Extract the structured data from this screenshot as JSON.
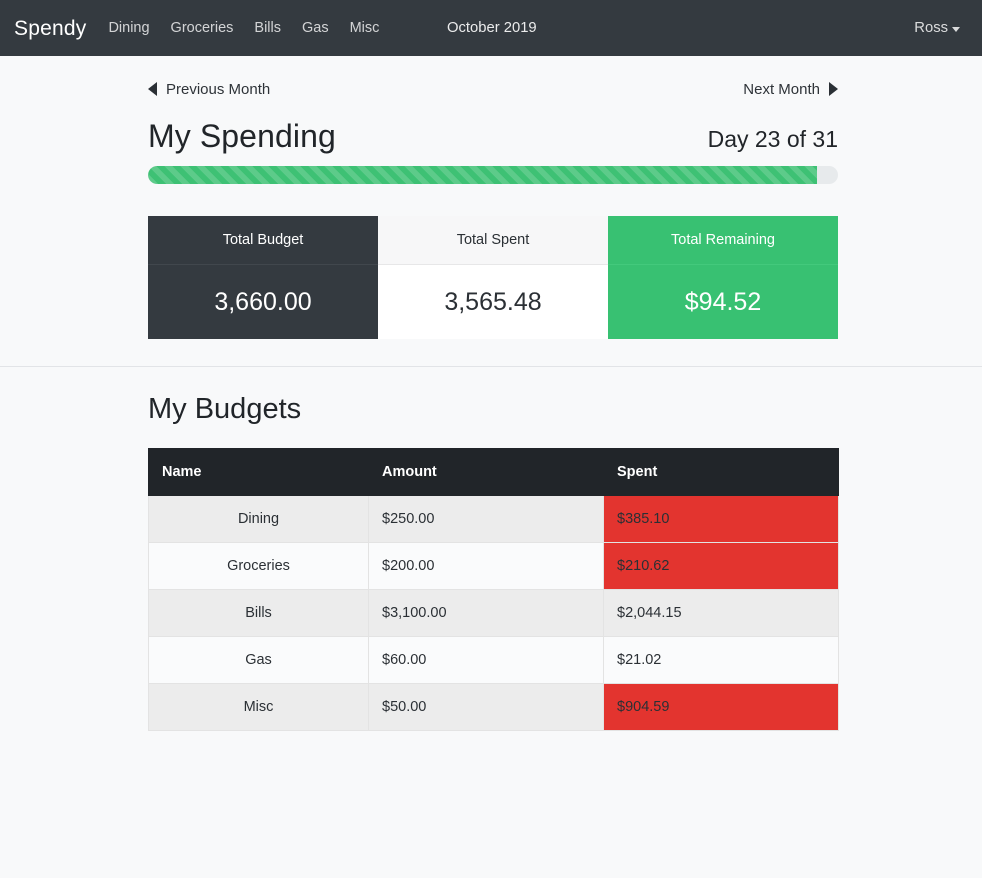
{
  "navbar": {
    "brand": "Spendy",
    "links": [
      {
        "label": "Dining"
      },
      {
        "label": "Groceries"
      },
      {
        "label": "Bills"
      },
      {
        "label": "Gas"
      },
      {
        "label": "Misc"
      }
    ],
    "month": "October 2019",
    "user": "Ross",
    "caret_icon": "chevron-down-icon"
  },
  "month_nav": {
    "previous_label": "Previous Month",
    "next_label": "Next Month",
    "prev_icon": "triangle-left-icon",
    "next_icon": "triangle-right-icon"
  },
  "spending": {
    "title": "My Spending",
    "day_counter": "Day 23 of 31",
    "progress_percent": 97,
    "progress_color": "#3ec174",
    "progress_track_color": "#e7eaec",
    "cards": [
      {
        "label": "Total Budget",
        "value": "3,660.00",
        "style": "dark",
        "color": "#343a40"
      },
      {
        "label": "Total Spent",
        "value": "3,565.48",
        "style": "light",
        "color": "#ffffff"
      },
      {
        "label": "Total Remaining",
        "value": "$94.52",
        "style": "green",
        "color": "#38c172"
      }
    ]
  },
  "budgets": {
    "title": "My Budgets",
    "columns": [
      "Name",
      "Amount",
      "Spent"
    ],
    "over_color": "#e3342f",
    "rows": [
      {
        "name": "Dining",
        "amount": "$250.00",
        "spent": "$385.10",
        "over": true
      },
      {
        "name": "Groceries",
        "amount": "$200.00",
        "spent": "$210.62",
        "over": true
      },
      {
        "name": "Bills",
        "amount": "$3,100.00",
        "spent": "$2,044.15",
        "over": false
      },
      {
        "name": "Gas",
        "amount": "$60.00",
        "spent": "$21.02",
        "over": false
      },
      {
        "name": "Misc",
        "amount": "$50.00",
        "spent": "$904.59",
        "over": true
      }
    ]
  }
}
